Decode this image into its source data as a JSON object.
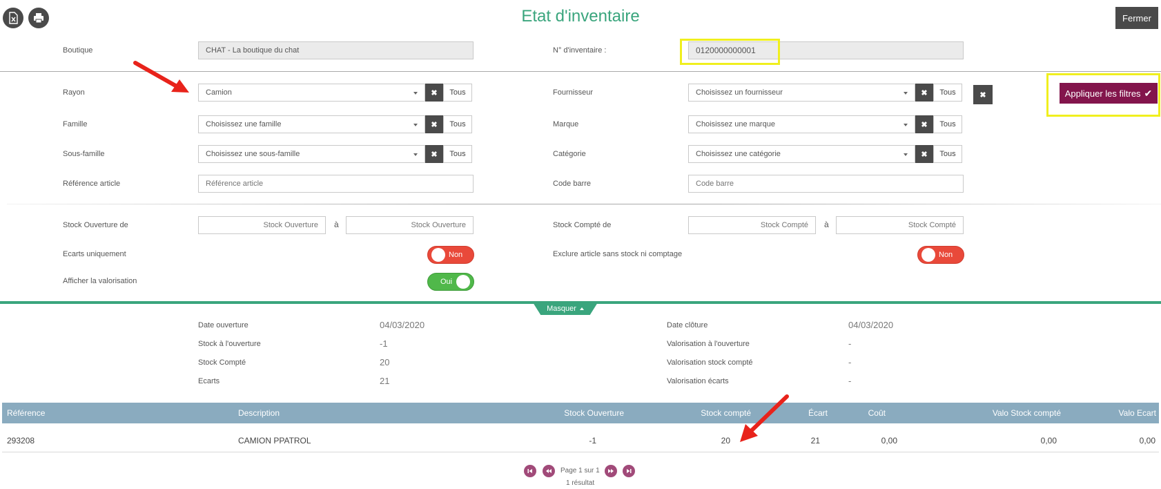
{
  "title": "Etat d'inventaire",
  "toolbar": {
    "close_label": "Fermer",
    "excel_icon": "excel-icon",
    "print_icon": "print-icon"
  },
  "header": {
    "boutique_label": "Boutique",
    "boutique_value": "CHAT - La boutique du chat",
    "inventory_label": "N° d'inventaire :",
    "inventory_value": "0120000000001"
  },
  "filters": {
    "rayon": {
      "label": "Rayon",
      "value": "Camion"
    },
    "famille": {
      "label": "Famille",
      "placeholder": "Choisissez une famille"
    },
    "sous_famille": {
      "label": "Sous-famille",
      "placeholder": "Choisissez une sous-famille"
    },
    "reference": {
      "label": "Référence article",
      "placeholder": "Référence article"
    },
    "fournisseur": {
      "label": "Fournisseur",
      "placeholder": "Choisissez un fournisseur"
    },
    "marque": {
      "label": "Marque",
      "placeholder": "Choisissez une marque"
    },
    "categorie": {
      "label": "Catégorie",
      "placeholder": "Choisissez une catégorie"
    },
    "code_barre": {
      "label": "Code barre",
      "placeholder": "Code barre"
    },
    "all_label": "Tous",
    "clear_symbol": "✖",
    "apply_label": "Appliquer les filtres",
    "apply_check": "✔"
  },
  "stock_filters": {
    "open_label": "Stock Ouverture de",
    "open_placeholder": "Stock Ouverture",
    "counted_label": "Stock Compté de",
    "counted_placeholder": "Stock Compté",
    "range_sep": "à",
    "ecarts_label": "Ecarts uniquement",
    "ecarts_value": "Non",
    "exclude_label": "Exclure article sans stock ni comptage",
    "exclude_value": "Non",
    "valorisation_label": "Afficher la valorisation",
    "valorisation_value": "Oui"
  },
  "collapse_label": "Masquer",
  "summary": {
    "date_open_label": "Date ouverture",
    "date_open": "04/03/2020",
    "stock_open_label": "Stock à l'ouverture",
    "stock_open": "-1",
    "stock_counted_label": "Stock Compté",
    "stock_counted": "20",
    "ecarts_label": "Ecarts",
    "ecarts": "21",
    "date_close_label": "Date clôture",
    "date_close": "04/03/2020",
    "valo_open_label": "Valorisation à l'ouverture",
    "valo_open": "-",
    "valo_counted_label": "Valorisation stock compté",
    "valo_counted": "-",
    "valo_ecarts_label": "Valorisation écarts",
    "valo_ecarts": "-"
  },
  "table": {
    "columns": [
      "Référence",
      "Description",
      "Stock Ouverture",
      "Stock compté",
      "Écart",
      "Coût",
      "Valo Stock compté",
      "Valo Ecart"
    ],
    "rows": [
      [
        "293208",
        "CAMION PPATROL",
        "-1",
        "20",
        "21",
        "0,00",
        "0,00",
        "0,00"
      ]
    ]
  },
  "pagination": {
    "page_text": "Page 1 sur 1",
    "results_text": "1 résultat"
  },
  "colors": {
    "accent": "#3aa57d",
    "apply": "#83154c",
    "danger": "#e9493a",
    "success": "#50b84a",
    "table_header": "#8aabbf",
    "highlight": "#f0ef1e",
    "annotation": "#e8231b"
  }
}
